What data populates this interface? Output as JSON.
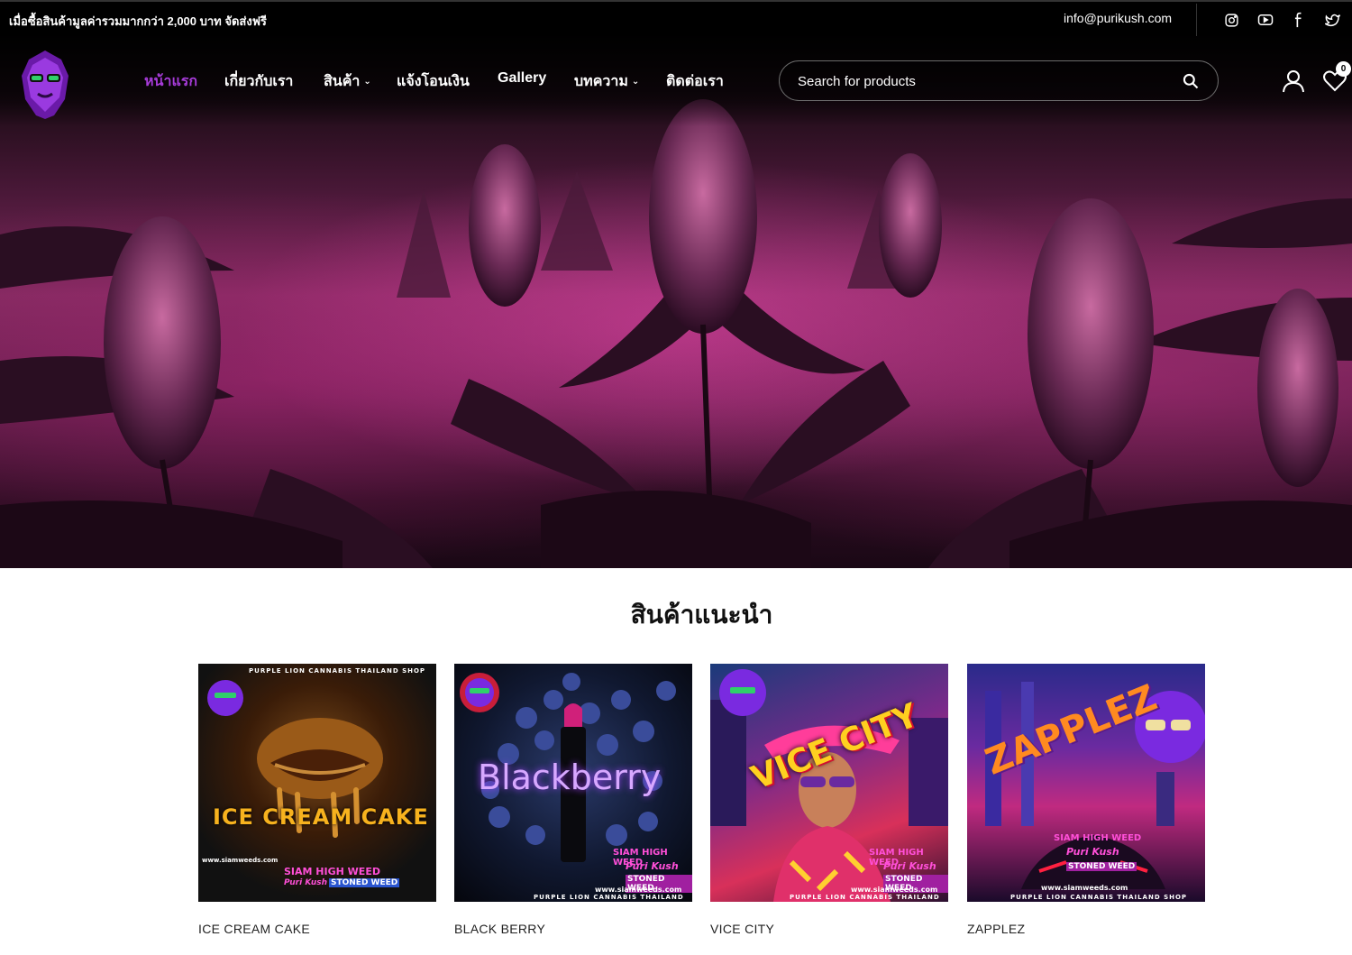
{
  "topbar": {
    "promo": "เมื่อซื้อสินค้ามูลค่ารวมมากกว่า 2,000 บาท จัดส่งฟรี",
    "email": "info@purikush.com",
    "social": [
      "instagram-icon",
      "youtube-icon",
      "facebook-icon",
      "twitter-icon"
    ]
  },
  "nav": {
    "items": [
      {
        "label": "หน้าแรก",
        "active": true
      },
      {
        "label": "เกี่ยวกับเรา"
      },
      {
        "label": "สินค้า",
        "dropdown": true
      },
      {
        "label": "แจ้งโอนเงิน"
      },
      {
        "label": "Gallery"
      },
      {
        "label": "บทความ",
        "dropdown": true
      },
      {
        "label": "ติดต่อเรา"
      }
    ],
    "search_placeholder": "Search for products",
    "wishlist_count": "0"
  },
  "featured": {
    "title": "สินค้าแนะนำ",
    "products": [
      {
        "name": "ICE CREAM CAKE",
        "art_title": "ICE CREAM CAKE",
        "shop": "PURPLE LION CANNABIS THAILAND SHOP",
        "site": "www.siamweeds.com",
        "brand1": "SIAM HIGH WEED",
        "brand2": "Puri Kush",
        "brand3": "STONED WEED"
      },
      {
        "name": "BLACK BERRY",
        "art_title": "Blackberry",
        "shop": "PURPLE LION CANNABIS THAILAND SHOP",
        "site": "www.siamweeds.com",
        "brand1": "SIAM HIGH WEED",
        "brand2": "Puri Kush",
        "brand3": "STONED WEED"
      },
      {
        "name": "VICE CITY",
        "art_title": "VICE CITY",
        "shop": "PURPLE LION CANNABIS THAILAND SHOP",
        "site": "www.siamweeds.com",
        "brand1": "SIAM HIGH WEED",
        "brand2": "Puri Kush",
        "brand3": "STONED WEED"
      },
      {
        "name": "ZAPPLEZ",
        "art_title": "ZAPPLEZ",
        "shop": "PURPLE LION CANNABIS THAILAND SHOP",
        "site": "www.siamweeds.com",
        "brand1": "SIAM HIGH WEED",
        "brand2": "Puri Kush",
        "brand3": "STONED WEED"
      }
    ]
  },
  "colors": {
    "accent": "#a63bd8",
    "topbar": "#000000",
    "hero": "#7e2a5d"
  }
}
